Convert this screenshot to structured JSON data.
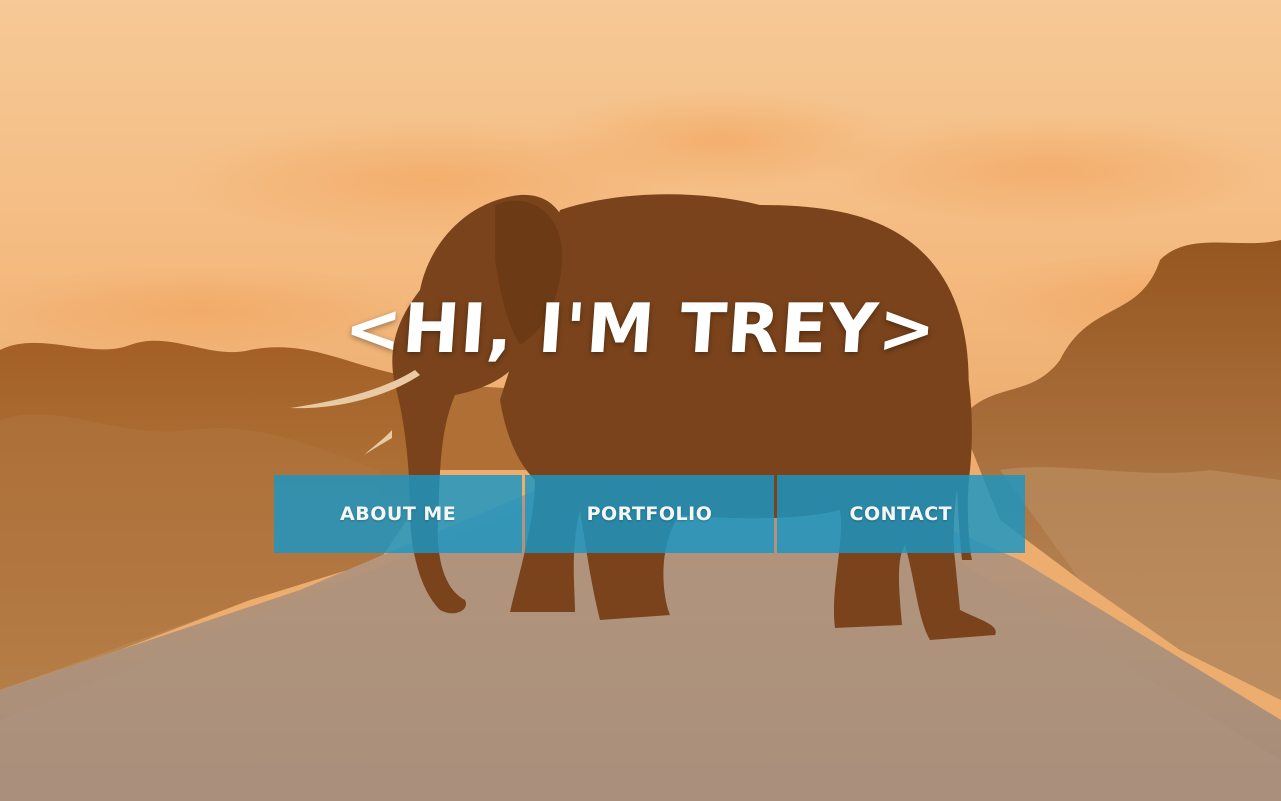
{
  "hero": {
    "title": "<HI, I'M TREY>"
  },
  "nav": {
    "items": [
      {
        "label": "ABOUT ME"
      },
      {
        "label": "PORTFOLIO"
      },
      {
        "label": "CONTACT"
      }
    ]
  },
  "colors": {
    "sky": "#f7c68f",
    "overlay": "#e88a2f",
    "button": "#1896c4",
    "text": "#ffffff"
  }
}
